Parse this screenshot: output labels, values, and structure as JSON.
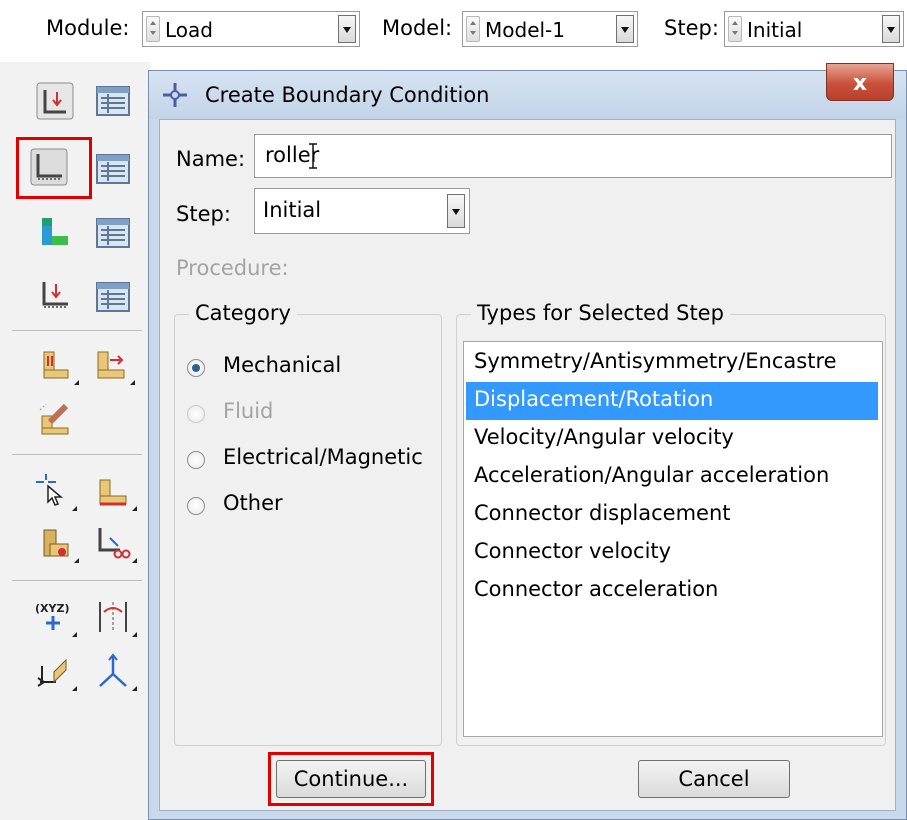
{
  "toolbar": {
    "module_label": "Module:",
    "module_value": "Load",
    "model_label": "Model:",
    "model_value": "Model-1",
    "step_label": "Step:",
    "step_value": "Initial"
  },
  "dialog": {
    "title": "Create Boundary Condition",
    "close_glyph": "x",
    "name_label": "Name:",
    "name_value": "roller",
    "step_label": "Step:",
    "step_value": "Initial",
    "procedure_label": "Procedure:",
    "category_legend": "Category",
    "categories": [
      {
        "label": "Mechanical",
        "checked": true,
        "enabled": true
      },
      {
        "label": "Fluid",
        "checked": false,
        "enabled": false
      },
      {
        "label": "Electrical/Magnetic",
        "checked": false,
        "enabled": true
      },
      {
        "label": "Other",
        "checked": false,
        "enabled": true
      }
    ],
    "types_legend": "Types for Selected Step",
    "types": [
      "Symmetry/Antisymmetry/Encastre",
      "Displacement/Rotation",
      "Velocity/Angular velocity",
      "Acceleration/Angular acceleration",
      "Connector displacement",
      "Connector velocity",
      "Connector acceleration"
    ],
    "selected_type": "Displacement/Rotation",
    "continue_label": "Continue...",
    "cancel_label": "Cancel"
  },
  "toolbox": {
    "xyz_label": "(XYZ)",
    "icons": [
      "create-load-icon",
      "load-manager-icon",
      "create-boundary-condition-icon",
      "boundary-condition-manager-icon",
      "create-predefined-field-icon",
      "predefined-field-manager-icon",
      "create-load-case-icon",
      "load-case-manager-icon",
      "create-special-icon",
      "create-amplitude-icon",
      "partition-edit-icon",
      "create-set-icon",
      "create-surface-icon",
      "create-rigid-body-icon",
      "remove-constraint-icon",
      "create-datum-point-icon",
      "create-datum-plane-icon",
      "create-datum-csys-icon",
      "create-datum-axis-icon"
    ]
  },
  "colors": {
    "selection": "#3399ff",
    "highlight_box": "#e00000",
    "close_button": "#c9503b"
  }
}
